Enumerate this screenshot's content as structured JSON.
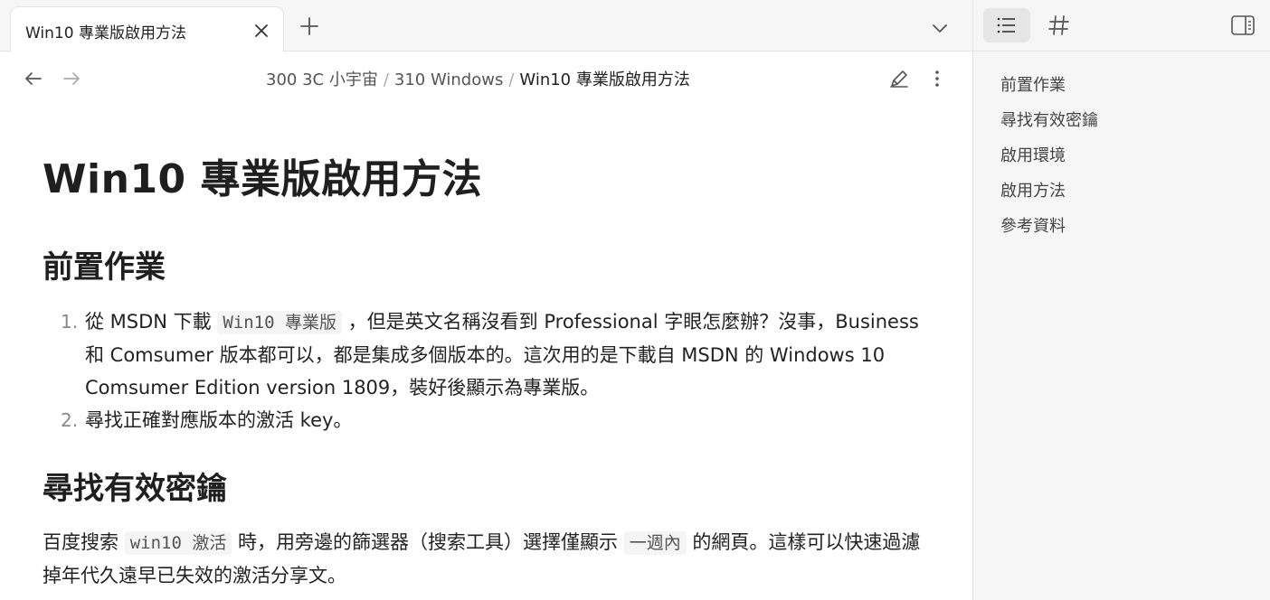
{
  "tab": {
    "title": "Win10 專業版啟用方法",
    "close_icon": "close-icon",
    "new_tab_icon": "plus-icon",
    "tab_list_icon": "chevron-down-icon"
  },
  "nav": {
    "back_icon": "arrow-left-icon",
    "forward_icon": "arrow-right-icon",
    "breadcrumb": [
      "300 3C 小宇宙",
      "310 Windows",
      "Win10 專業版啟用方法"
    ],
    "separator": "/",
    "edit_icon": "pencil-icon",
    "more_icon": "more-vertical-icon"
  },
  "document": {
    "title": "Win10 專業版啟用方法",
    "section1": {
      "heading": "前置作業",
      "items": [
        {
          "number": "1.",
          "prefix": "從 MSDN 下載 ",
          "code": "Win10 專業版",
          "suffix": " ，但是英文名稱沒看到 Professional 字眼怎麼辦？沒事，Business 和 Comsumer 版本都可以，都是集成多個版本的。這次用的是下載自 MSDN 的 Windows 10 Comsumer Edition version 1809，裝好後顯示為專業版。"
        },
        {
          "number": "2.",
          "text": "尋找正確對應版本的激活 key。"
        }
      ]
    },
    "section2": {
      "heading": "尋找有效密鑰",
      "para_part1": "百度搜索 ",
      "para_code1": "win10 激活",
      "para_part2": " 時，用旁邊的篩選器（搜索工具）選擇僅顯示 ",
      "para_code2": "一週內",
      "para_part3": " 的網頁。這樣可以快速過濾掉年代久遠早已失效的激活分享文。"
    }
  },
  "sidebar": {
    "outline_icon": "list-icon",
    "tags_icon": "hash-icon",
    "toggle_icon": "sidebar-toggle-icon",
    "outline": [
      "前置作業",
      "尋找有效密鑰",
      "啟用環境",
      "啟用方法",
      "參考資料"
    ]
  },
  "colors": {
    "background": "#ffffff",
    "sidebar_bg": "#f6f6f6",
    "text": "#222222",
    "muted": "#888888",
    "code_bg": "#f5f5f5"
  }
}
